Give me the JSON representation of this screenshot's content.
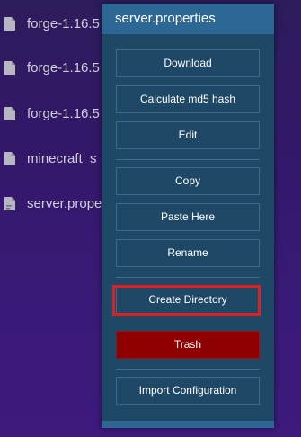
{
  "files": [
    {
      "name": "forge-1.16.5",
      "icon": "file-icon"
    },
    {
      "name": "forge-1.16.5",
      "icon": "file-icon"
    },
    {
      "name": "forge-1.16.5",
      "icon": "file-icon"
    },
    {
      "name": "minecraft_s",
      "icon": "file-icon"
    },
    {
      "name": "server.prope",
      "icon": "file-text-icon"
    }
  ],
  "context_menu": {
    "title": "server.properties",
    "items": {
      "download": "Download",
      "md5": "Calculate md5 hash",
      "edit": "Edit",
      "copy": "Copy",
      "paste": "Paste Here",
      "rename": "Rename",
      "create_directory": "Create Directory",
      "trash": "Trash",
      "import_configuration": "Import Configuration"
    },
    "highlighted_item": "create_directory"
  },
  "colors": {
    "background": "#33186a",
    "menu_background": "#1f4766",
    "menu_header": "#2c6796",
    "trash_button": "#8f0000",
    "highlight": "#e02020"
  }
}
